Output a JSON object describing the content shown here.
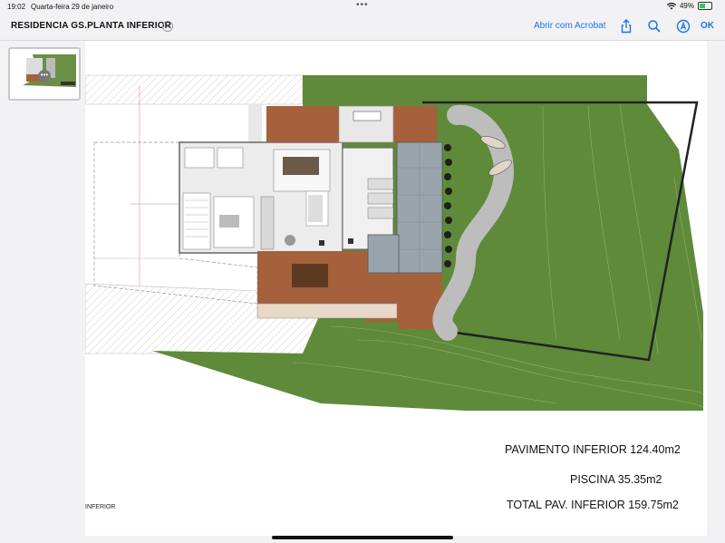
{
  "status": {
    "time": "19:02",
    "date": "Quarta-feira 29 de janeiro",
    "battery": "49%",
    "battery_level": 0.49
  },
  "toolbar": {
    "title": "RESIDENCIA GS.PLANTA INFERIOR",
    "acrobat": "Abrir com Acrobat",
    "ok": "OK",
    "icons": [
      "share-icon",
      "search-icon",
      "markup-icon"
    ]
  },
  "sidebar": {
    "thumbnail_more": "•••"
  },
  "drawing": {
    "areas": [
      "PAVIMENTO INFERIOR 124.40m2",
      "PISCINA 35.35m2",
      "TOTAL PAV. INFERIOR 159.75m2"
    ],
    "footer_label": "INFERIOR"
  },
  "colors": {
    "accent": "#1a73e8",
    "lawn": "#5f8a3a",
    "deck": "#a5603c",
    "pool": "#9aa4ac"
  }
}
